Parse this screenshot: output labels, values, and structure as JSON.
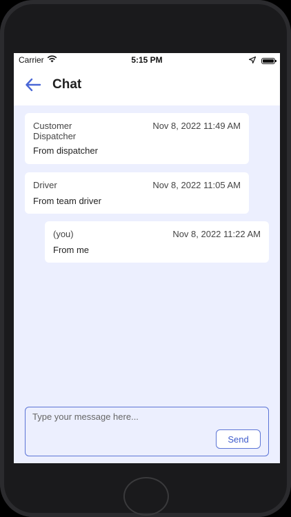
{
  "status_bar": {
    "carrier": "Carrier",
    "time": "5:15 PM",
    "icons": [
      "wifi-icon",
      "location-arrow-icon",
      "battery-icon"
    ]
  },
  "app_bar": {
    "title": "Chat",
    "back_icon": "arrow-left-icon",
    "accent_color": "#4a67d6"
  },
  "messages": [
    {
      "sender": "Customer Dispatcher",
      "timestamp": "Nov 8, 2022 11:49 AM",
      "text": "From dispatcher"
    },
    {
      "sender": "Driver",
      "timestamp": "Nov 8, 2022 11:05 AM",
      "text": "From team driver"
    },
    {
      "sender": "(you)",
      "timestamp": "Nov 8, 2022 11:22 AM",
      "text": "From me"
    }
  ],
  "composer": {
    "placeholder": "Type your message here...",
    "value": "",
    "send_label": "Send"
  },
  "colors": {
    "background": "#eceffe",
    "bubble": "#ffffff",
    "accent": "#4a67d6"
  }
}
